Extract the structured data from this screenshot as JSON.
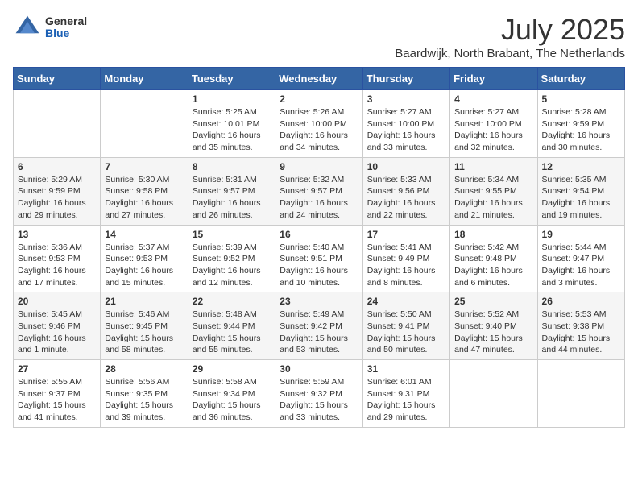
{
  "logo": {
    "general": "General",
    "blue": "Blue"
  },
  "title": {
    "month": "July 2025",
    "location": "Baardwijk, North Brabant, The Netherlands"
  },
  "weekdays": [
    "Sunday",
    "Monday",
    "Tuesday",
    "Wednesday",
    "Thursday",
    "Friday",
    "Saturday"
  ],
  "weeks": [
    [
      {
        "day": "",
        "info": ""
      },
      {
        "day": "",
        "info": ""
      },
      {
        "day": "1",
        "info": "Sunrise: 5:25 AM\nSunset: 10:01 PM\nDaylight: 16 hours\nand 35 minutes."
      },
      {
        "day": "2",
        "info": "Sunrise: 5:26 AM\nSunset: 10:00 PM\nDaylight: 16 hours\nand 34 minutes."
      },
      {
        "day": "3",
        "info": "Sunrise: 5:27 AM\nSunset: 10:00 PM\nDaylight: 16 hours\nand 33 minutes."
      },
      {
        "day": "4",
        "info": "Sunrise: 5:27 AM\nSunset: 10:00 PM\nDaylight: 16 hours\nand 32 minutes."
      },
      {
        "day": "5",
        "info": "Sunrise: 5:28 AM\nSunset: 9:59 PM\nDaylight: 16 hours\nand 30 minutes."
      }
    ],
    [
      {
        "day": "6",
        "info": "Sunrise: 5:29 AM\nSunset: 9:59 PM\nDaylight: 16 hours\nand 29 minutes."
      },
      {
        "day": "7",
        "info": "Sunrise: 5:30 AM\nSunset: 9:58 PM\nDaylight: 16 hours\nand 27 minutes."
      },
      {
        "day": "8",
        "info": "Sunrise: 5:31 AM\nSunset: 9:57 PM\nDaylight: 16 hours\nand 26 minutes."
      },
      {
        "day": "9",
        "info": "Sunrise: 5:32 AM\nSunset: 9:57 PM\nDaylight: 16 hours\nand 24 minutes."
      },
      {
        "day": "10",
        "info": "Sunrise: 5:33 AM\nSunset: 9:56 PM\nDaylight: 16 hours\nand 22 minutes."
      },
      {
        "day": "11",
        "info": "Sunrise: 5:34 AM\nSunset: 9:55 PM\nDaylight: 16 hours\nand 21 minutes."
      },
      {
        "day": "12",
        "info": "Sunrise: 5:35 AM\nSunset: 9:54 PM\nDaylight: 16 hours\nand 19 minutes."
      }
    ],
    [
      {
        "day": "13",
        "info": "Sunrise: 5:36 AM\nSunset: 9:53 PM\nDaylight: 16 hours\nand 17 minutes."
      },
      {
        "day": "14",
        "info": "Sunrise: 5:37 AM\nSunset: 9:53 PM\nDaylight: 16 hours\nand 15 minutes."
      },
      {
        "day": "15",
        "info": "Sunrise: 5:39 AM\nSunset: 9:52 PM\nDaylight: 16 hours\nand 12 minutes."
      },
      {
        "day": "16",
        "info": "Sunrise: 5:40 AM\nSunset: 9:51 PM\nDaylight: 16 hours\nand 10 minutes."
      },
      {
        "day": "17",
        "info": "Sunrise: 5:41 AM\nSunset: 9:49 PM\nDaylight: 16 hours\nand 8 minutes."
      },
      {
        "day": "18",
        "info": "Sunrise: 5:42 AM\nSunset: 9:48 PM\nDaylight: 16 hours\nand 6 minutes."
      },
      {
        "day": "19",
        "info": "Sunrise: 5:44 AM\nSunset: 9:47 PM\nDaylight: 16 hours\nand 3 minutes."
      }
    ],
    [
      {
        "day": "20",
        "info": "Sunrise: 5:45 AM\nSunset: 9:46 PM\nDaylight: 16 hours\nand 1 minute."
      },
      {
        "day": "21",
        "info": "Sunrise: 5:46 AM\nSunset: 9:45 PM\nDaylight: 15 hours\nand 58 minutes."
      },
      {
        "day": "22",
        "info": "Sunrise: 5:48 AM\nSunset: 9:44 PM\nDaylight: 15 hours\nand 55 minutes."
      },
      {
        "day": "23",
        "info": "Sunrise: 5:49 AM\nSunset: 9:42 PM\nDaylight: 15 hours\nand 53 minutes."
      },
      {
        "day": "24",
        "info": "Sunrise: 5:50 AM\nSunset: 9:41 PM\nDaylight: 15 hours\nand 50 minutes."
      },
      {
        "day": "25",
        "info": "Sunrise: 5:52 AM\nSunset: 9:40 PM\nDaylight: 15 hours\nand 47 minutes."
      },
      {
        "day": "26",
        "info": "Sunrise: 5:53 AM\nSunset: 9:38 PM\nDaylight: 15 hours\nand 44 minutes."
      }
    ],
    [
      {
        "day": "27",
        "info": "Sunrise: 5:55 AM\nSunset: 9:37 PM\nDaylight: 15 hours\nand 41 minutes."
      },
      {
        "day": "28",
        "info": "Sunrise: 5:56 AM\nSunset: 9:35 PM\nDaylight: 15 hours\nand 39 minutes."
      },
      {
        "day": "29",
        "info": "Sunrise: 5:58 AM\nSunset: 9:34 PM\nDaylight: 15 hours\nand 36 minutes."
      },
      {
        "day": "30",
        "info": "Sunrise: 5:59 AM\nSunset: 9:32 PM\nDaylight: 15 hours\nand 33 minutes."
      },
      {
        "day": "31",
        "info": "Sunrise: 6:01 AM\nSunset: 9:31 PM\nDaylight: 15 hours\nand 29 minutes."
      },
      {
        "day": "",
        "info": ""
      },
      {
        "day": "",
        "info": ""
      }
    ]
  ]
}
